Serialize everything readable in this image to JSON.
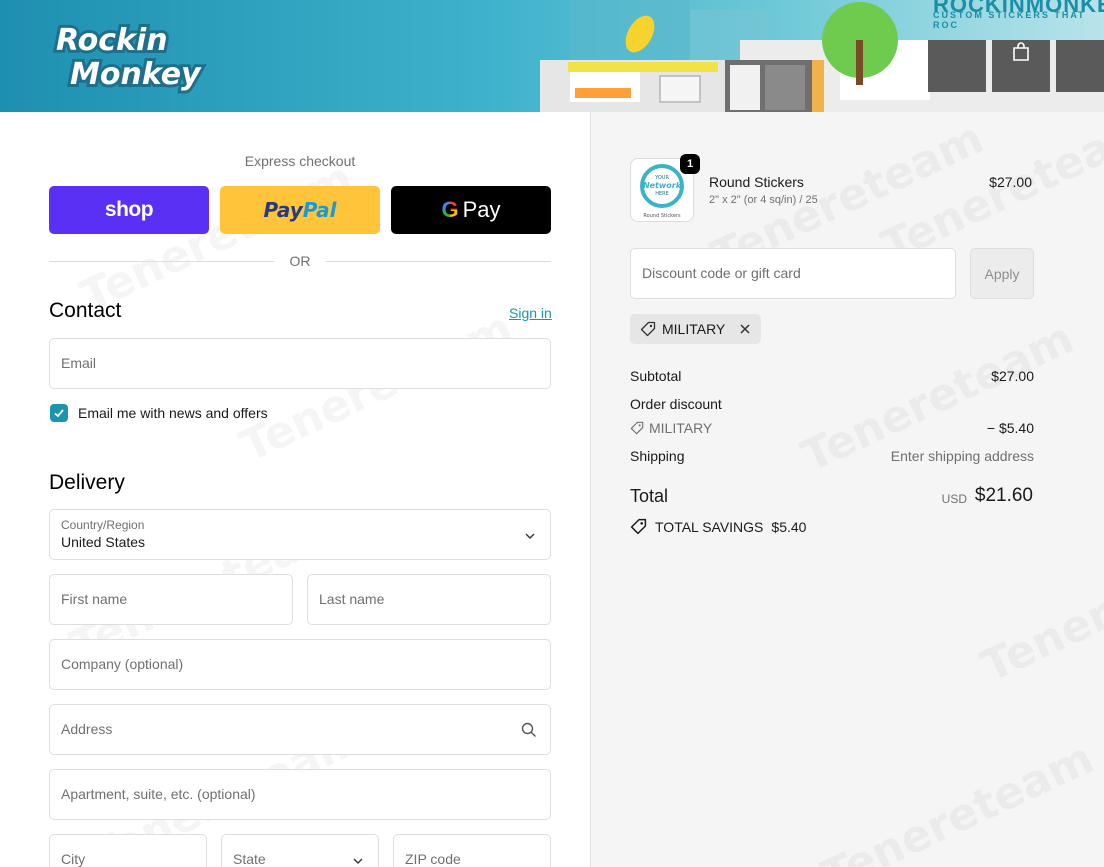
{
  "header": {
    "logo_line1": "Rockin",
    "logo_line2": "Monkey",
    "brand_title": "ROCKINMONKEY",
    "brand_tagline": "CUSTOM STICKERS THAT ROC"
  },
  "express": {
    "title": "Express checkout",
    "shop_label": "shop",
    "paypal_label_1": "Pay",
    "paypal_label_2": "Pal",
    "gpay_g": "G",
    "gpay_label": "Pay",
    "or_label": "OR"
  },
  "contact": {
    "title": "Contact",
    "signin_label": "Sign in",
    "email_placeholder": "Email",
    "newsletter_label": "Email me with news and offers",
    "newsletter_checked": true
  },
  "delivery": {
    "title": "Delivery",
    "country_label": "Country/Region",
    "country_value": "United States",
    "first_name_placeholder": "First name",
    "last_name_placeholder": "Last name",
    "company_placeholder": "Company (optional)",
    "address_placeholder": "Address",
    "apartment_placeholder": "Apartment, suite, etc. (optional)",
    "city_placeholder": "City",
    "state_placeholder": "State",
    "zip_placeholder": "ZIP code"
  },
  "order": {
    "item": {
      "quantity": "1",
      "name": "Round Stickers",
      "variant": "2\" x 2\" (or 4 sq/in) / 25",
      "price": "$27.00",
      "thumb_line1": "YOUR",
      "thumb_line2": "Network",
      "thumb_line3": "HERE",
      "thumb_caption": "Round Stickers"
    },
    "discount_placeholder": "Discount code or gift card",
    "apply_label": "Apply",
    "applied_code": "MILITARY",
    "subtotal_label": "Subtotal",
    "subtotal_value": "$27.00",
    "order_discount_label": "Order discount",
    "discount_code_label": "MILITARY",
    "discount_value": "− $5.40",
    "shipping_label": "Shipping",
    "shipping_value": "Enter shipping address",
    "total_label": "Total",
    "total_currency": "USD",
    "total_value": "$21.60",
    "savings_label": "TOTAL SAVINGS",
    "savings_value": "$5.40"
  },
  "colors": {
    "accent": "#1b94b0",
    "shop_pay": "#5a31f4",
    "paypal": "#ffc439",
    "gpay": "#000000"
  }
}
